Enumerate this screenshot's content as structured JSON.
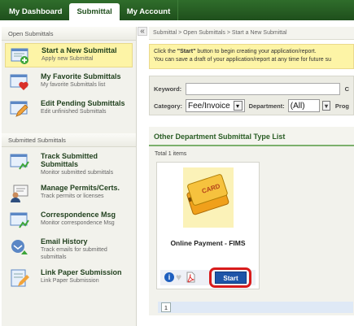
{
  "nav": {
    "tabs": [
      {
        "label": "My Dashboard"
      },
      {
        "label": "Submittal"
      },
      {
        "label": "My Account"
      }
    ]
  },
  "sidebar": {
    "open_header": "Open Submittals",
    "submitted_header": "Submitted Submittals",
    "open_items": [
      {
        "title": "Start a New Submittal",
        "sub": "Apply new Submittal"
      },
      {
        "title": "My Favorite Submittals",
        "sub": "My favorite Submittals list"
      },
      {
        "title": "Edit Pending Submittals",
        "sub": "Edit unfinished Submittals"
      }
    ],
    "submitted_items": [
      {
        "title": "Track Submitted Submittals",
        "sub": "Monitor submitted submittals"
      },
      {
        "title": "Manage Permits/Certs.",
        "sub": "Track permits or licenses"
      },
      {
        "title": "Correspondence Msg",
        "sub": "Monitor correspondence Msg"
      },
      {
        "title": "Email History",
        "sub": "Track emails for submitted submittals"
      },
      {
        "title": "Link Paper Submission",
        "sub": "Link Paper Submission"
      }
    ],
    "collapse_glyph": "«"
  },
  "main": {
    "breadcrumb": "Submittal > Open Submittals > Start a New Submittal",
    "notice": {
      "line1_pre": "Click the ",
      "line1_bold": "\"Start\"",
      "line1_post": " button to begin creating your application/report.",
      "line2": "You can save a draft of your application/report at any time for future su"
    },
    "filters": {
      "keyword_label": "Keyword:",
      "keyword_value": "",
      "keyword_trail": "C",
      "category_label": "Category:",
      "category_value": "Fee/Invoice",
      "department_label": "Department:",
      "department_value": "(All)",
      "program_label": "Prog"
    },
    "list": {
      "title": "Other Department Submittal Type List",
      "total": "Total 1 items",
      "cards": [
        {
          "title": "Online Payment - FIMS",
          "image_text": "CARD",
          "start_label": "Start"
        }
      ],
      "page": "1"
    }
  },
  "colors": {
    "nav_green": "#1f4f1c",
    "highlight_yellow": "#fdf4a6",
    "start_blue": "#1d54a8",
    "callout_red": "#d81b1b"
  }
}
